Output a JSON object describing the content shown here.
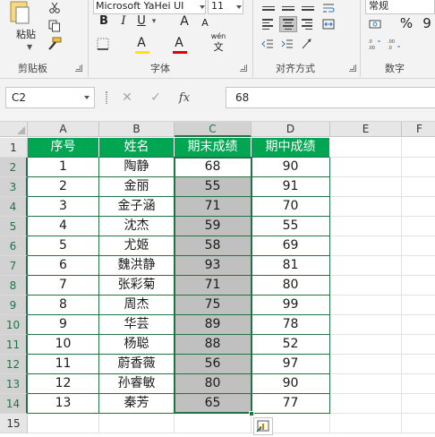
{
  "ribbon": {
    "clipboard": {
      "paste_label": "粘贴",
      "group_label": "剪贴板"
    },
    "font": {
      "font_name": "Microsoft YaHei UI",
      "font_size": "11",
      "group_label": "字体",
      "grow": "A",
      "shrink": "A",
      "bold": "B",
      "italic": "I",
      "underline": "U",
      "underline_caret": "▾",
      "highlight": "A",
      "font_color": "A",
      "phonetic_top": "wén",
      "phonetic_bottom": "文"
    },
    "alignment": {
      "group_label": "对齐方式"
    },
    "number": {
      "format": "常规",
      "group_label": "数字",
      "percent": "%",
      "comma": "9"
    },
    "colors": {
      "highlight": "#ffe600",
      "font_color": "#e00000",
      "ribbon_bg": "#f3f3f3",
      "accent": "#217346"
    }
  },
  "formula_bar": {
    "name_box": "C2",
    "cancel_icon": "✕",
    "enter_icon": "✓",
    "fx_icon": "fx",
    "value": "68"
  },
  "grid": {
    "columns": [
      "A",
      "B",
      "C",
      "D",
      "E",
      "F"
    ],
    "rows": [
      "1",
      "2",
      "3",
      "4",
      "5",
      "6",
      "7",
      "8",
      "9",
      "10",
      "11",
      "12",
      "13",
      "14",
      "15"
    ],
    "header_row": [
      "序号",
      "姓名",
      "期末成绩",
      "期中成绩"
    ],
    "data": [
      [
        "1",
        "陶静",
        "68",
        "90"
      ],
      [
        "2",
        "金丽",
        "55",
        "91"
      ],
      [
        "3",
        "金子涵",
        "71",
        "70"
      ],
      [
        "4",
        "沈杰",
        "59",
        "55"
      ],
      [
        "5",
        "尤姬",
        "58",
        "69"
      ],
      [
        "6",
        "魏洪静",
        "93",
        "81"
      ],
      [
        "7",
        "张彩菊",
        "71",
        "80"
      ],
      [
        "8",
        "周杰",
        "75",
        "99"
      ],
      [
        "9",
        "华芸",
        "89",
        "78"
      ],
      [
        "10",
        "杨聪",
        "88",
        "52"
      ],
      [
        "11",
        "蔚香薇",
        "56",
        "97"
      ],
      [
        "12",
        "孙睿敏",
        "80",
        "90"
      ],
      [
        "13",
        "秦芳",
        "65",
        "77"
      ]
    ],
    "header_color": "#00a651",
    "selection_fill": "#c0c0c0",
    "selected_range": "C2:C14"
  }
}
